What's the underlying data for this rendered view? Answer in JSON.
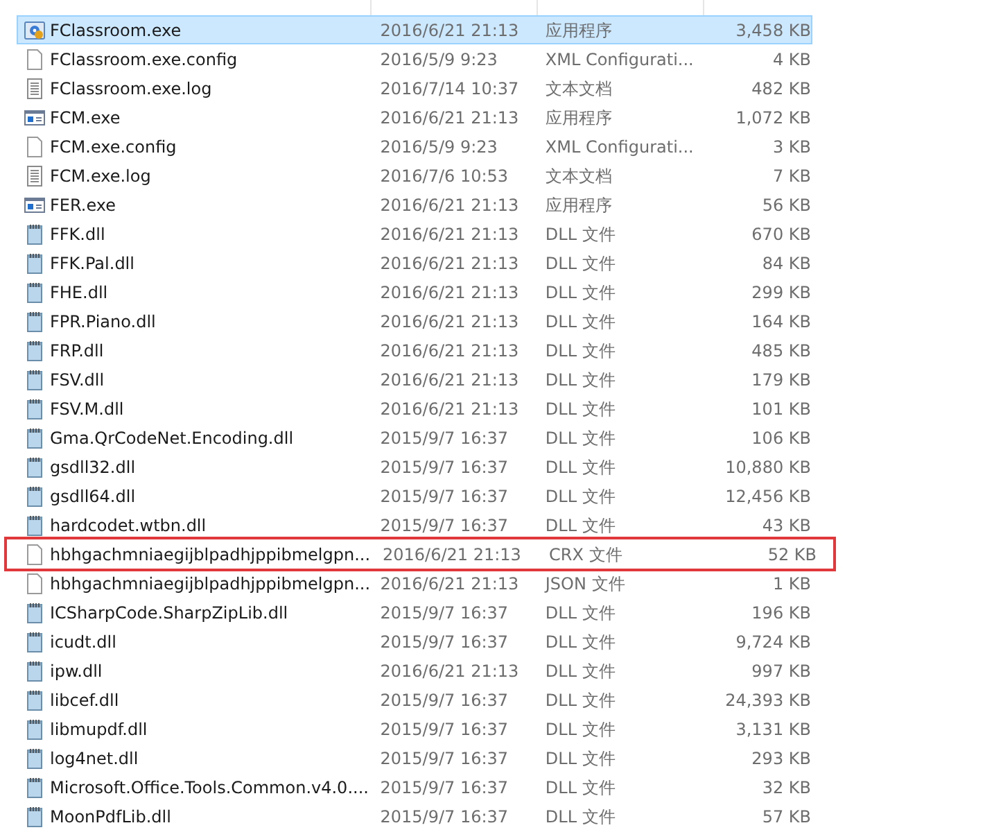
{
  "files": [
    {
      "name": "FClassroom.exe",
      "modified": "2016/6/21 21:13",
      "type": "应用程序",
      "size": "3,458 KB",
      "kind": "app-gear",
      "selected": true,
      "outlined": false
    },
    {
      "name": "FClassroom.exe.config",
      "modified": "2016/5/9 9:23",
      "type": "XML Configurati...",
      "size": "4 KB",
      "kind": "blank",
      "selected": false,
      "outlined": false
    },
    {
      "name": "FClassroom.exe.log",
      "modified": "2016/7/14 10:37",
      "type": "文本文档",
      "size": "482 KB",
      "kind": "text",
      "selected": false,
      "outlined": false
    },
    {
      "name": "FCM.exe",
      "modified": "2016/6/21 21:13",
      "type": "应用程序",
      "size": "1,072 KB",
      "kind": "app",
      "selected": false,
      "outlined": false
    },
    {
      "name": "FCM.exe.config",
      "modified": "2016/5/9 9:23",
      "type": "XML Configurati...",
      "size": "3 KB",
      "kind": "blank",
      "selected": false,
      "outlined": false
    },
    {
      "name": "FCM.exe.log",
      "modified": "2016/7/6 10:53",
      "type": "文本文档",
      "size": "7 KB",
      "kind": "text",
      "selected": false,
      "outlined": false
    },
    {
      "name": "FER.exe",
      "modified": "2016/6/21 21:13",
      "type": "应用程序",
      "size": "56 KB",
      "kind": "app",
      "selected": false,
      "outlined": false
    },
    {
      "name": "FFK.dll",
      "modified": "2016/6/21 21:13",
      "type": "DLL 文件",
      "size": "670 KB",
      "kind": "dll",
      "selected": false,
      "outlined": false
    },
    {
      "name": "FFK.Pal.dll",
      "modified": "2016/6/21 21:13",
      "type": "DLL 文件",
      "size": "84 KB",
      "kind": "dll",
      "selected": false,
      "outlined": false
    },
    {
      "name": "FHE.dll",
      "modified": "2016/6/21 21:13",
      "type": "DLL 文件",
      "size": "299 KB",
      "kind": "dll",
      "selected": false,
      "outlined": false
    },
    {
      "name": "FPR.Piano.dll",
      "modified": "2016/6/21 21:13",
      "type": "DLL 文件",
      "size": "164 KB",
      "kind": "dll",
      "selected": false,
      "outlined": false
    },
    {
      "name": "FRP.dll",
      "modified": "2016/6/21 21:13",
      "type": "DLL 文件",
      "size": "485 KB",
      "kind": "dll",
      "selected": false,
      "outlined": false
    },
    {
      "name": "FSV.dll",
      "modified": "2016/6/21 21:13",
      "type": "DLL 文件",
      "size": "179 KB",
      "kind": "dll",
      "selected": false,
      "outlined": false
    },
    {
      "name": "FSV.M.dll",
      "modified": "2016/6/21 21:13",
      "type": "DLL 文件",
      "size": "101 KB",
      "kind": "dll",
      "selected": false,
      "outlined": false
    },
    {
      "name": "Gma.QrCodeNet.Encoding.dll",
      "modified": "2015/9/7 16:37",
      "type": "DLL 文件",
      "size": "106 KB",
      "kind": "dll",
      "selected": false,
      "outlined": false
    },
    {
      "name": "gsdll32.dll",
      "modified": "2015/9/7 16:37",
      "type": "DLL 文件",
      "size": "10,880 KB",
      "kind": "dll",
      "selected": false,
      "outlined": false
    },
    {
      "name": "gsdll64.dll",
      "modified": "2015/9/7 16:37",
      "type": "DLL 文件",
      "size": "12,456 KB",
      "kind": "dll",
      "selected": false,
      "outlined": false
    },
    {
      "name": "hardcodet.wtbn.dll",
      "modified": "2015/9/7 16:37",
      "type": "DLL 文件",
      "size": "43 KB",
      "kind": "dll",
      "selected": false,
      "outlined": false
    },
    {
      "name": "hbhgachmniaegijblpadhjppibmelgpn...",
      "modified": "2016/6/21 21:13",
      "type": "CRX 文件",
      "size": "52 KB",
      "kind": "blank",
      "selected": false,
      "outlined": true
    },
    {
      "name": "hbhgachmniaegijblpadhjppibmelgpn...",
      "modified": "2016/6/21 21:13",
      "type": "JSON 文件",
      "size": "1 KB",
      "kind": "blank",
      "selected": false,
      "outlined": false
    },
    {
      "name": "ICSharpCode.SharpZipLib.dll",
      "modified": "2015/9/7 16:37",
      "type": "DLL 文件",
      "size": "196 KB",
      "kind": "dll",
      "selected": false,
      "outlined": false
    },
    {
      "name": "icudt.dll",
      "modified": "2015/9/7 16:37",
      "type": "DLL 文件",
      "size": "9,724 KB",
      "kind": "dll",
      "selected": false,
      "outlined": false
    },
    {
      "name": "ipw.dll",
      "modified": "2016/6/21 21:13",
      "type": "DLL 文件",
      "size": "997 KB",
      "kind": "dll",
      "selected": false,
      "outlined": false
    },
    {
      "name": "libcef.dll",
      "modified": "2015/9/7 16:37",
      "type": "DLL 文件",
      "size": "24,393 KB",
      "kind": "dll",
      "selected": false,
      "outlined": false
    },
    {
      "name": "libmupdf.dll",
      "modified": "2015/9/7 16:37",
      "type": "DLL 文件",
      "size": "3,131 KB",
      "kind": "dll",
      "selected": false,
      "outlined": false
    },
    {
      "name": "log4net.dll",
      "modified": "2015/9/7 16:37",
      "type": "DLL 文件",
      "size": "293 KB",
      "kind": "dll",
      "selected": false,
      "outlined": false
    },
    {
      "name": "Microsoft.Office.Tools.Common.v4.0....",
      "modified": "2015/9/7 16:37",
      "type": "DLL 文件",
      "size": "32 KB",
      "kind": "dll",
      "selected": false,
      "outlined": false
    },
    {
      "name": "MoonPdfLib.dll",
      "modified": "2015/9/7 16:37",
      "type": "DLL 文件",
      "size": "57 KB",
      "kind": "dll",
      "selected": false,
      "outlined": false
    }
  ]
}
